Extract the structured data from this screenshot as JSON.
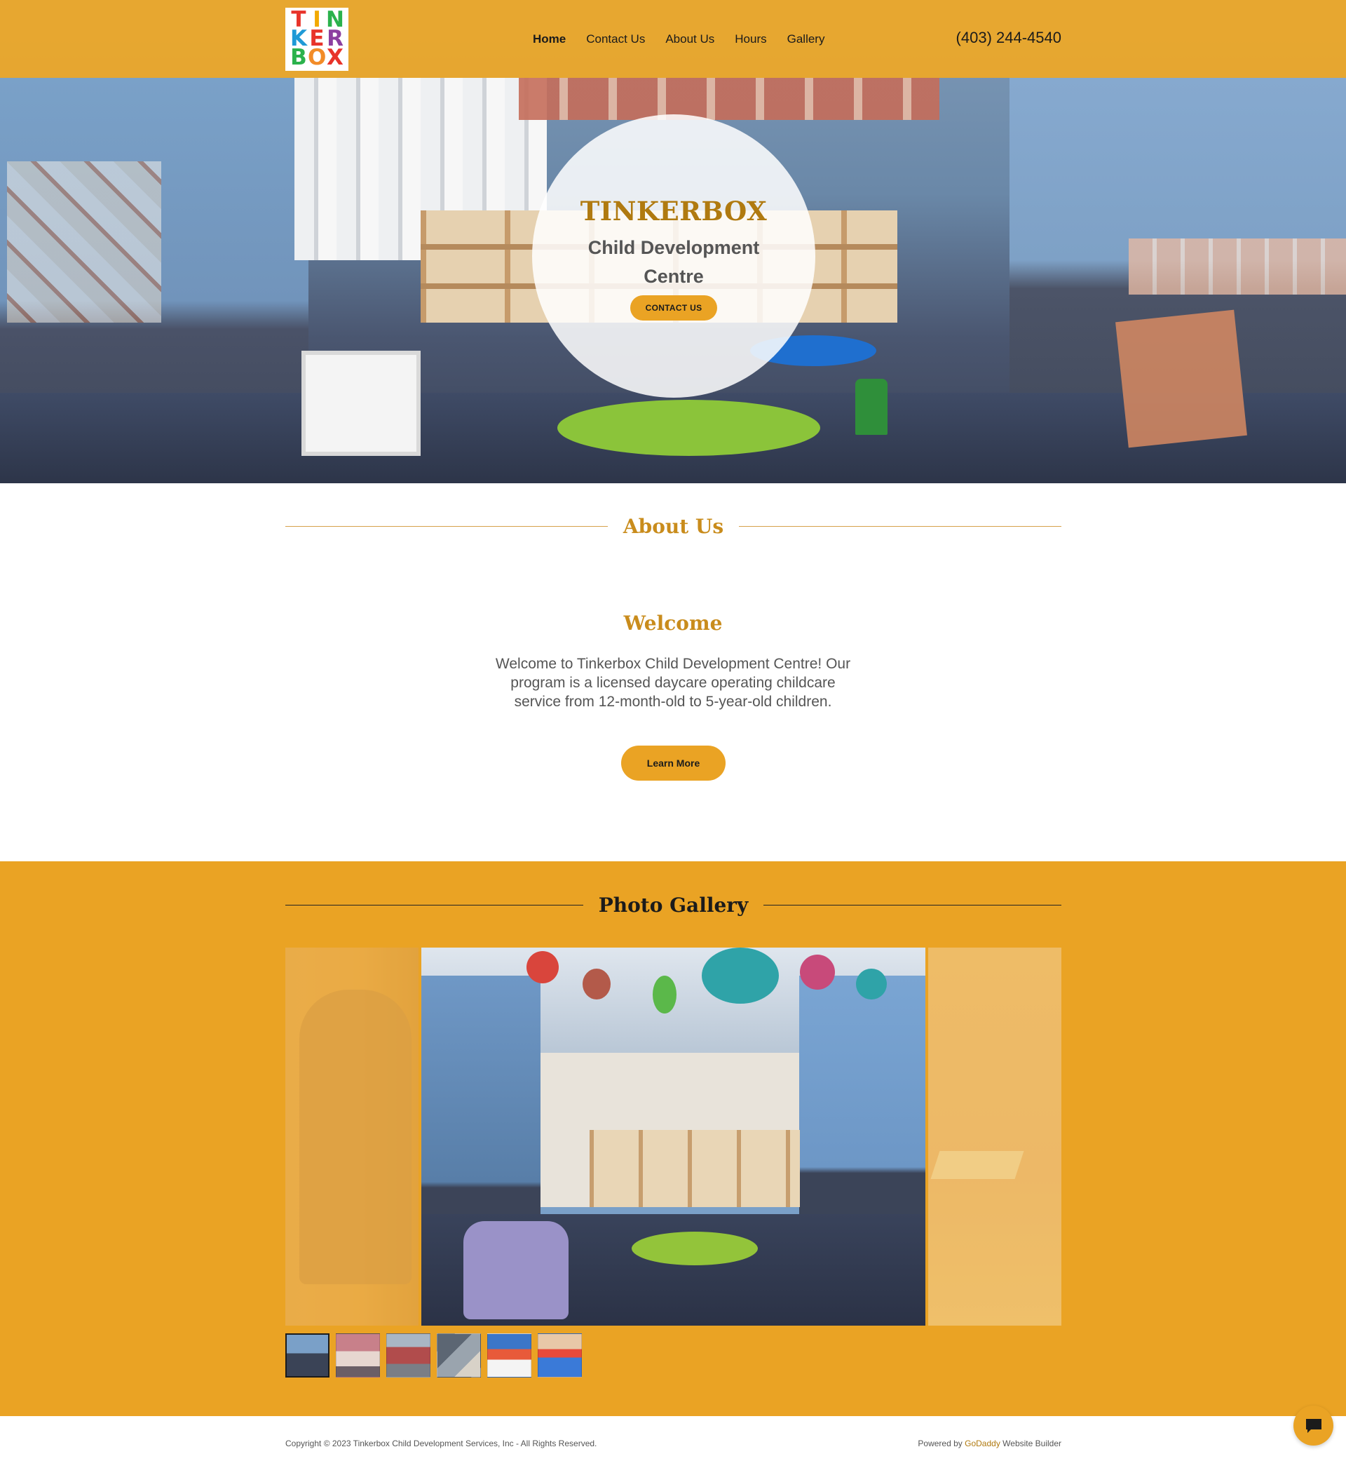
{
  "header": {
    "logo": {
      "rows": [
        [
          {
            "ch": "T",
            "color": "#e8332a"
          },
          {
            "ch": "I",
            "color": "#f2a900"
          },
          {
            "ch": "N",
            "color": "#2bb24c"
          }
        ],
        [
          {
            "ch": "K",
            "color": "#1f9ad6"
          },
          {
            "ch": "E",
            "color": "#e8332a"
          },
          {
            "ch": "R",
            "color": "#8c3fa0"
          }
        ],
        [
          {
            "ch": "B",
            "color": "#2bb24c"
          },
          {
            "ch": "O",
            "color": "#f28c28"
          },
          {
            "ch": "X",
            "color": "#e8332a"
          }
        ]
      ]
    },
    "nav": [
      "Home",
      "Contact Us",
      "About Us",
      "Hours",
      "Gallery"
    ],
    "active_nav": "Home",
    "phone": "(403) 244-4540"
  },
  "hero": {
    "title": "TINKERBOX",
    "subtitle": "Child Development Centre",
    "cta": "CONTACT US"
  },
  "about": {
    "heading": "About Us",
    "welcome_title": "Welcome",
    "welcome_text": "Welcome to Tinkerbox Child Development Centre! Our program is a licensed daycare operating childcare service from 12-month-old to 5-year-old children.",
    "cta": "Learn More"
  },
  "gallery": {
    "heading": "Photo Gallery",
    "thumbnail_count": 6,
    "active_thumbnail": 1
  },
  "footer": {
    "copyright": "Copyright © 2023 Tinkerbox Child Development Services, Inc - All Rights Reserved.",
    "powered_prefix": "Powered by",
    "powered_brand": "GoDaddy",
    "powered_suffix": "Website Builder"
  },
  "icons": {
    "chat": "chat-bubble-icon"
  },
  "colors": {
    "accent": "#eaa324",
    "heading_gold": "#c98c1c",
    "hero_title": "#b07a10"
  }
}
